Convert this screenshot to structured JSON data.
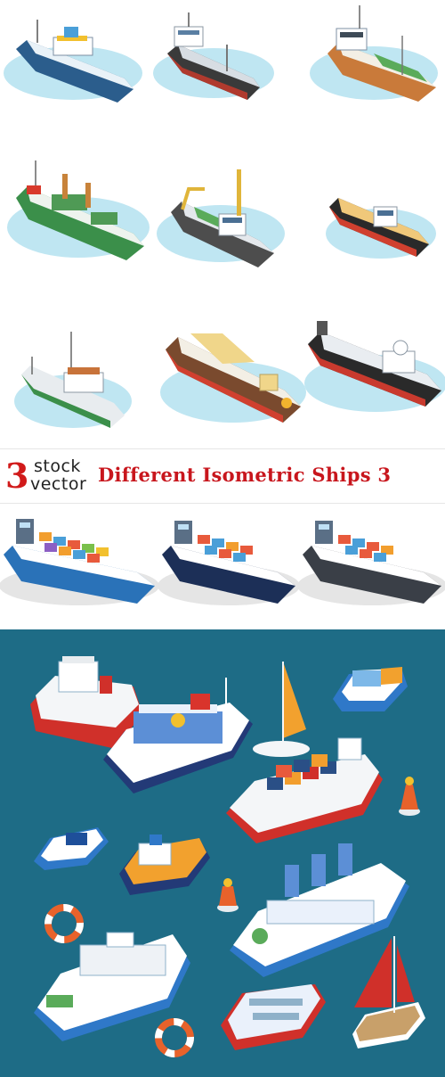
{
  "banner": {
    "logo_number": "3",
    "logo_word_top": "stock",
    "logo_word_bottom": "vector",
    "title": "Different Isometric Ships 3"
  },
  "colors": {
    "accent_red": "#c8161d",
    "sea_panel": "#1e6c86",
    "water_light": "#bfe6f2"
  }
}
